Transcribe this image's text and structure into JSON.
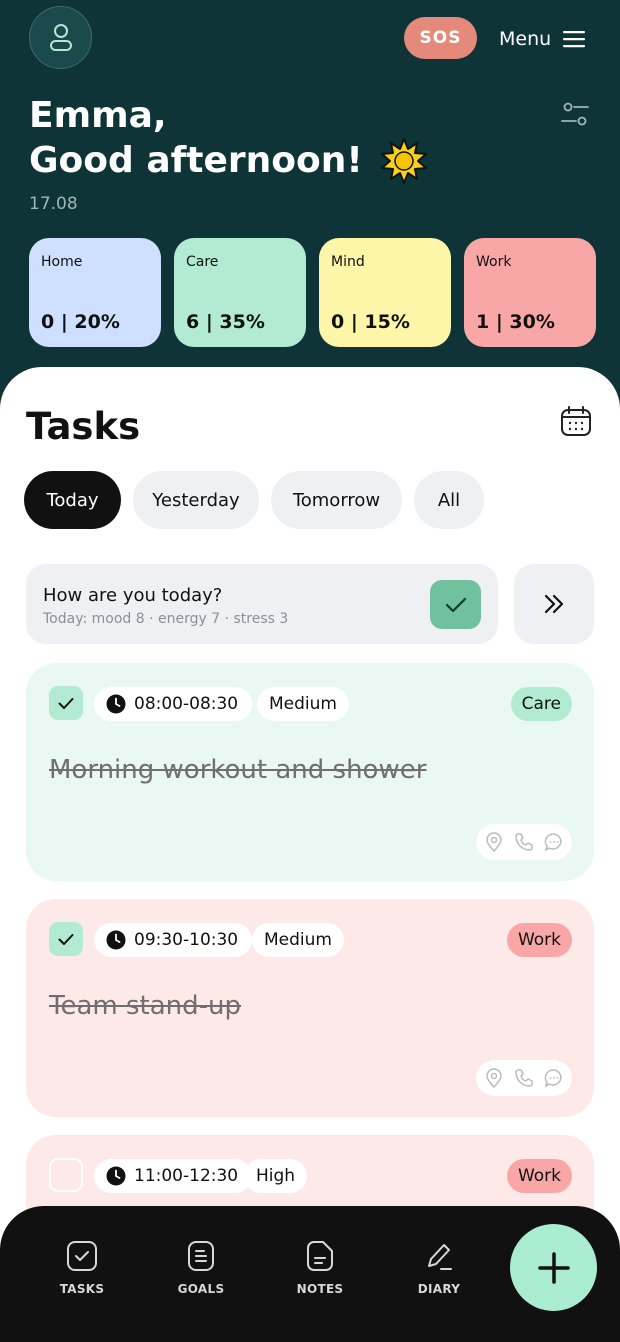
{
  "header": {
    "sos_label": "SOS",
    "menu_label": "Menu",
    "greeting_name": "Emma,",
    "greeting_text": "Good afternoon!",
    "date": "17.08"
  },
  "categories": [
    {
      "name": "Home",
      "value": "0 | 20%",
      "color": "#cfdfff"
    },
    {
      "name": "Care",
      "value": "6 | 35%",
      "color": "#b3ead2"
    },
    {
      "name": "Mind",
      "value": "0 | 15%",
      "color": "#fdf6a9"
    },
    {
      "name": "Work",
      "value": "1 | 30%",
      "color": "#f8a7a6"
    }
  ],
  "tasks_section": {
    "title": "Tasks",
    "tabs": [
      "Today",
      "Yesterday",
      "Tomorrow",
      "All"
    ],
    "active_tab": "Today"
  },
  "mood": {
    "question": "How are you today?",
    "summary": "Today: mood 8 · energy 7 · stress 3"
  },
  "tasks": [
    {
      "time": "08:00-08:30",
      "priority": "Medium",
      "category": "Care",
      "title": "Morning workout and shower",
      "done": true,
      "bg": "#e9f8f2",
      "tag_color": "#b3ead2"
    },
    {
      "time": "09:30-10:30",
      "priority": "Medium",
      "category": "Work",
      "title": "Team stand-up",
      "done": true,
      "bg": "#fde9e8",
      "tag_color": "#f8a7a6"
    },
    {
      "time": "11:00-12:30",
      "priority": "High",
      "category": "Work",
      "title": "",
      "done": false,
      "bg": "#fde9e8",
      "tag_color": "#f8a7a6"
    }
  ],
  "nav": {
    "tasks": "TASKS",
    "goals": "GOALS",
    "notes": "NOTES",
    "diary": "DIARY"
  },
  "icons": {
    "avatar": "user-icon",
    "menu": "hamburger-icon",
    "filter": "filter-icon",
    "sun": "sun-icon",
    "calendar": "calendar-icon",
    "check": "check-icon",
    "next": "double-chevron-icon",
    "clock": "clock-icon",
    "location": "location-icon",
    "phone": "phone-icon",
    "comment": "comment-icon",
    "add": "plus-icon"
  }
}
